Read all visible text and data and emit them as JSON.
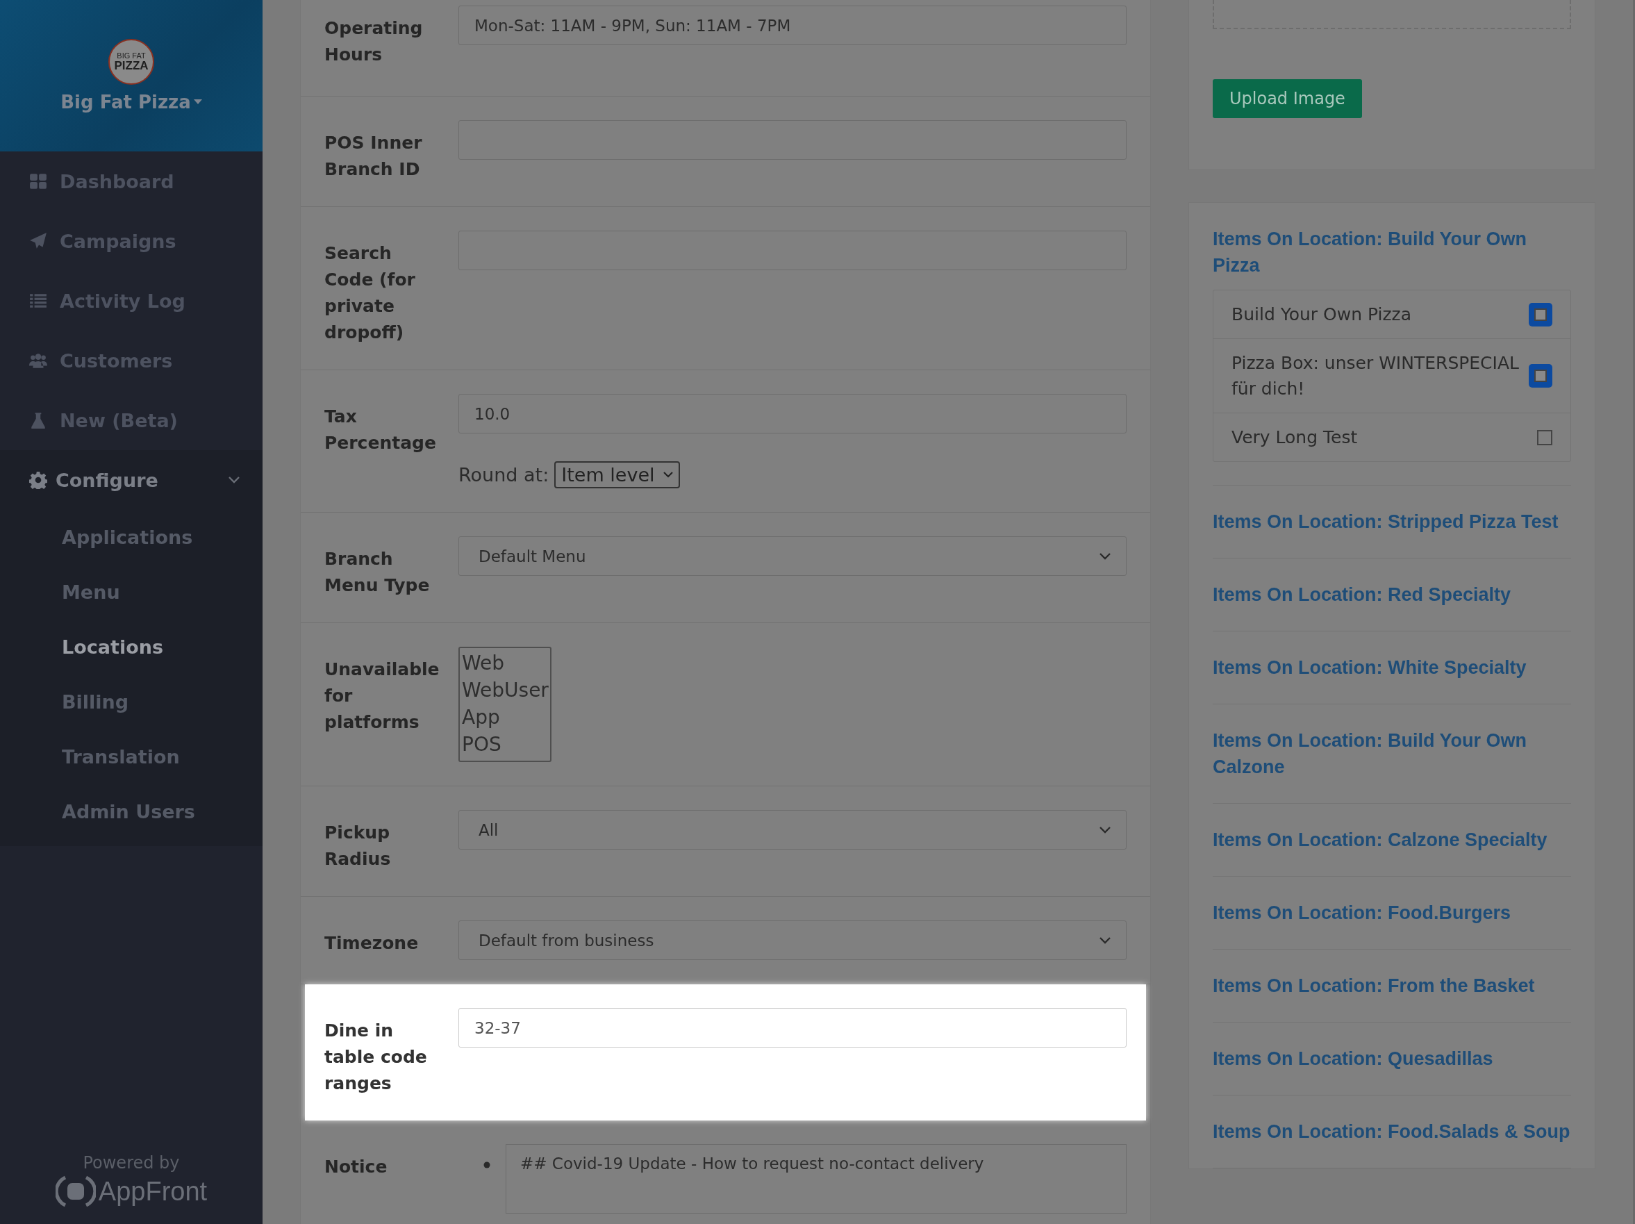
{
  "sidebar": {
    "logo_text": [
      "BIG FAT",
      "PIZZA"
    ],
    "brand": "Big Fat Pizza",
    "items": [
      {
        "label": "Dashboard",
        "selected": false
      },
      {
        "label": "Campaigns",
        "selected": false
      },
      {
        "label": "Activity Log",
        "selected": false
      },
      {
        "label": "Customers",
        "selected": false
      },
      {
        "label": "New (Beta)",
        "selected": false
      }
    ],
    "configure": {
      "label": "Configure",
      "expanded": true,
      "children": [
        {
          "label": "Applications",
          "selected": false
        },
        {
          "label": "Menu",
          "selected": false
        },
        {
          "label": "Locations",
          "selected": true
        },
        {
          "label": "Billing",
          "selected": false
        },
        {
          "label": "Translation",
          "selected": false
        },
        {
          "label": "Admin Users",
          "selected": false
        }
      ]
    },
    "powered_by": "Powered by",
    "powered_brand": "AppFront"
  },
  "form": {
    "fields": [
      {
        "kind": "text",
        "label": "Operating Hours",
        "value": "Mon-Sat: 11AM - 9PM, Sun: 11AM - 7PM",
        "highlighted": false
      },
      {
        "kind": "text",
        "label": "POS Inner Branch ID",
        "highlighted": false
      },
      {
        "kind": "text",
        "label": "Search Code (for private dropoff)",
        "highlighted": false
      },
      {
        "kind": "tax",
        "label": "Tax Percentage",
        "value": "10.0",
        "round_label": "Round at:",
        "round_value": "Item level",
        "highlighted": false
      },
      {
        "kind": "select",
        "label": "Branch Menu Type",
        "value": "Default Menu",
        "highlighted": false
      },
      {
        "kind": "listbox",
        "label": "Unavailable for platforms",
        "options": [
          "Web",
          "WebUser",
          "App",
          "POS"
        ],
        "highlighted": false
      },
      {
        "kind": "select",
        "label": "Pickup Radius",
        "value": "All",
        "highlighted": false
      },
      {
        "kind": "select",
        "label": "Timezone",
        "value": "Default from business",
        "highlighted": false
      },
      {
        "kind": "text",
        "label": "Dine in table code ranges",
        "value": "32-37",
        "highlighted": true
      },
      {
        "kind": "notice",
        "label": "Notice",
        "value": "## Covid-19 Update - How to request no-contact delivery",
        "highlighted": false
      }
    ]
  },
  "right": {
    "upload_button": "Upload Image",
    "sections": [
      {
        "title": "Items On Location: Build Your Own Pizza",
        "items": [
          {
            "label": "Build Your Own Pizza",
            "checked": true
          },
          {
            "label": "Pizza Box: unser WINTERSPECIAL für dich!",
            "checked": true
          },
          {
            "label": "Very Long Test",
            "checked": false
          }
        ]
      },
      {
        "title": "Items On Location: Stripped Pizza Test"
      },
      {
        "title": "Items On Location: Red Specialty"
      },
      {
        "title": "Items On Location: White Specialty"
      },
      {
        "title": "Items On Location: Build Your Own Calzone"
      },
      {
        "title": "Items On Location: Calzone Specialty"
      },
      {
        "title": "Items On Location: Food.Burgers"
      },
      {
        "title": "Items On Location: From the Basket"
      },
      {
        "title": "Items On Location: Quesadillas"
      },
      {
        "title": "Items On Location: Food.Salads & Soup"
      }
    ]
  }
}
